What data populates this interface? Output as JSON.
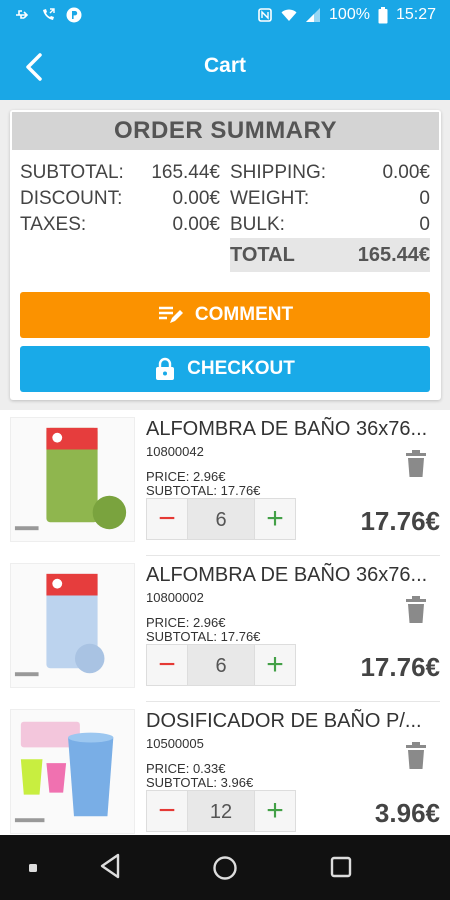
{
  "status_bar": {
    "battery": "100%",
    "time": "15:27"
  },
  "header": {
    "title": "Cart"
  },
  "summary": {
    "heading": "ORDER SUMMARY",
    "subtotal_label": "SUBTOTAL:",
    "subtotal_value": "165.44€",
    "discount_label": "DISCOUNT:",
    "discount_value": "0.00€",
    "taxes_label": "TAXES:",
    "taxes_value": "0.00€",
    "shipping_label": "SHIPPING:",
    "shipping_value": "0.00€",
    "weight_label": "WEIGHT:",
    "weight_value": "0",
    "bulk_label": "BULK:",
    "bulk_value": "0",
    "total_label": "TOTAL",
    "total_value": "165.44€"
  },
  "buttons": {
    "comment": "COMMENT",
    "checkout": "CHECKOUT"
  },
  "colors": {
    "primary": "#1aa7e6",
    "comment_button": "#fb9200",
    "checkout_button": "#19aae8",
    "minus": "#e53935",
    "plus": "#43a047"
  },
  "cart_items": [
    {
      "title": "ALFOMBRA DE BAÑO 36x76...",
      "code": "10800042",
      "price": "PRICE: 2.96€",
      "subtotal_line": "SUBTOTAL: 17.76€",
      "quantity": "6",
      "subtotal": "17.76€"
    },
    {
      "title": "ALFOMBRA DE BAÑO 36x76...",
      "code": "10800002",
      "price": "PRICE: 2.96€",
      "subtotal_line": "SUBTOTAL: 17.76€",
      "quantity": "6",
      "subtotal": "17.76€"
    },
    {
      "title": "DOSIFICADOR DE BAÑO P/...",
      "code": "10500005",
      "price": "PRICE: 0.33€",
      "subtotal_line": "SUBTOTAL: 3.96€",
      "quantity": "12",
      "subtotal": "3.96€"
    }
  ],
  "stepper": {
    "minus": "−",
    "plus": "+"
  }
}
